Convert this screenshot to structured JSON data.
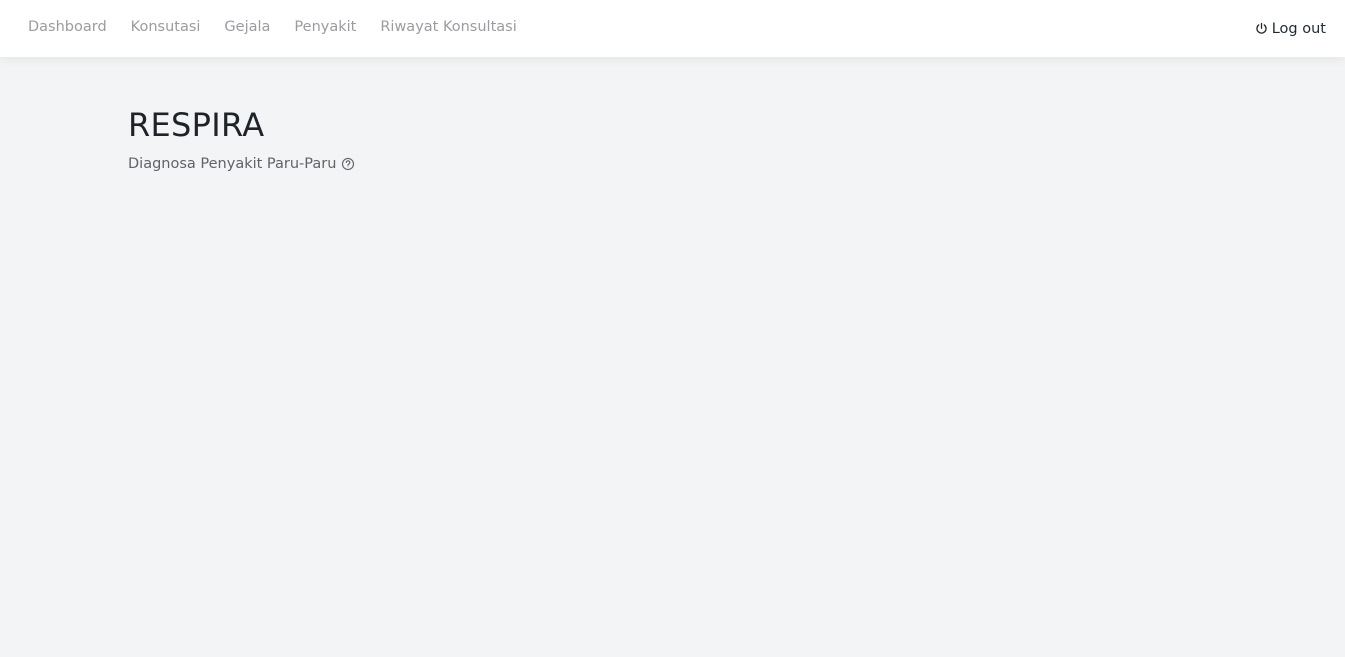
{
  "nav": {
    "items": [
      {
        "label": "Dashboard"
      },
      {
        "label": "Konsutasi"
      },
      {
        "label": "Gejala"
      },
      {
        "label": "Penyakit"
      },
      {
        "label": "Riwayat Konsultasi"
      }
    ],
    "logout": {
      "label": "Log out",
      "icon": "power-icon"
    }
  },
  "main": {
    "title": "RESPIRA",
    "subtitle": "Diagnosa Penyakit Paru-Paru",
    "subtitle_icon": "help-circle-icon"
  },
  "colors": {
    "background": "#f3f4f6",
    "navbar": "#ffffff",
    "nav_link": "#9a9ca1",
    "title": "#1f2328",
    "subtitle": "#5f6368"
  }
}
